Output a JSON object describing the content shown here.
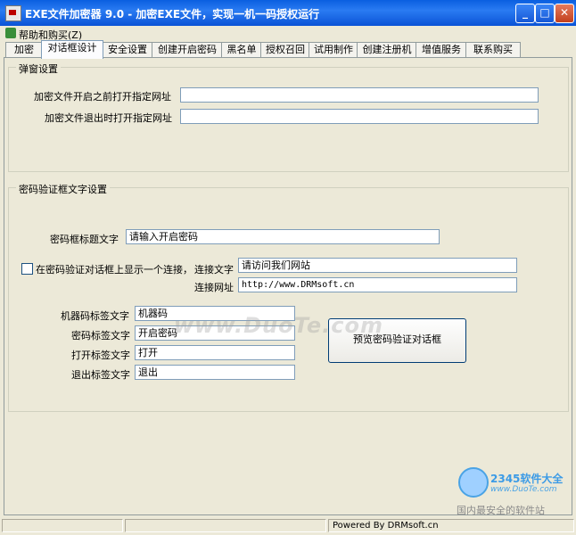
{
  "window": {
    "title": "EXE文件加密器 9.0 - 加密EXE文件，实现一机一码授权运行"
  },
  "menu": {
    "help": "帮助和购买(Z)"
  },
  "tabs": [
    "加密",
    "对话框设计",
    "安全设置",
    "创建开启密码",
    "黑名单",
    "授权召回",
    "试用制作",
    "创建注册机",
    "增值服务",
    "联系购买"
  ],
  "active_tab": "对话框设计",
  "popup_group": {
    "title": "弹窗设置",
    "open_url_label": "加密文件开启之前打开指定网址",
    "open_url_value": "",
    "exit_url_label": "加密文件退出时打开指定网址",
    "exit_url_value": ""
  },
  "password_group": {
    "title": "密码验证框文字设置",
    "dialog_title_label": "密码框标题文字",
    "dialog_title_value": "请输入开启密码",
    "show_link_checkbox_label": "在密码验证对话框上显示一个连接，",
    "show_link_checked": false,
    "link_text_label": "连接文字",
    "link_text_value": "请访问我们网站",
    "link_url_label": "连接网址",
    "link_url_value": "http://www.DRMsoft.cn",
    "machine_code_label": "机器码标签文字",
    "machine_code_value": "机器码",
    "password_label": "密码标签文字",
    "password_value": "开启密码",
    "open_label": "打开标签文字",
    "open_value": "打开",
    "exit_label": "退出标签文字",
    "exit_value": "退出",
    "preview_button": "预览密码验证对话框"
  },
  "statusbar": {
    "powered_by": "Powered By DRMsoft.cn"
  },
  "watermarks": {
    "center": "www.DuoTe.com",
    "brand": "2345软件大全",
    "brand_url": "www.DuoTe.com",
    "slogan": "国内最安全的软件站"
  }
}
